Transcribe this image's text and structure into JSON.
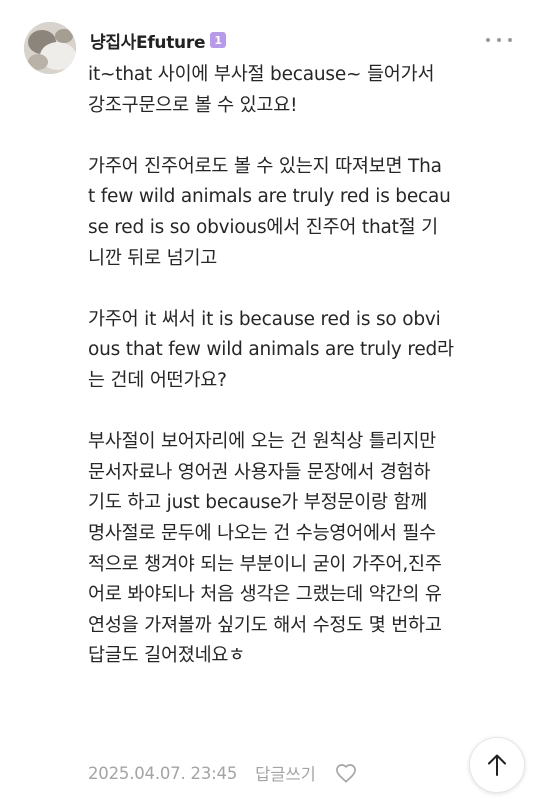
{
  "comment": {
    "author": "냥집사Efuture",
    "level_badge": "1",
    "body": [
      [
        "it~that 사이에 부사절 because~ 들어가서",
        "강조구문으로 볼 수 있고요!"
      ],
      [
        "가주어 진주어로도 볼 수 있는지 따져보면 Tha",
        "t few wild animals are truly red is becau",
        "se red is so obvious에서 진주어 that절 기",
        "니깐 뒤로 넘기고"
      ],
      [
        "가주어 it 써서 it is because red is so obvi",
        "ous that few wild animals are truly red라",
        "는 건데 어떤가요?"
      ],
      [
        "부사절이 보어자리에 오는 건 원칙상 틀리지만",
        "문서자료나 영어권 사용자들 문장에서 경험하",
        "기도 하고 just because가 부정문이랑 함께",
        "명사절로 문두에 나오는 건 수능영어에서 필수",
        "적으로 챙겨야 되는 부분이니 굳이 가주어,진주",
        "어로 봐야되나 처음 생각은 그랬는데 약간의 유",
        "연성을 가져볼까 싶기도 해서 수정도 몇 번하고",
        "답글도 길어졌네요ㅎ"
      ]
    ],
    "date": "2025.04.07. 23:45",
    "reply_label": "답글쓰기"
  },
  "icons": {
    "more": "more-dots-icon",
    "like": "heart-icon",
    "scroll_top": "arrow-up-icon"
  },
  "colors": {
    "badge": "#b89be8",
    "meta_text": "#a4a4a4",
    "body_text": "#262626"
  }
}
